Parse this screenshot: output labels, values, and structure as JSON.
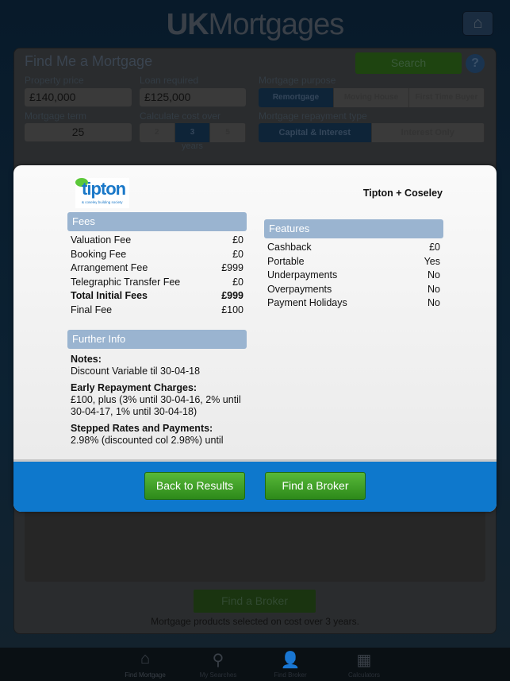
{
  "header": {
    "title_bold": "UK",
    "title_rest": "Mortgages",
    "home_icon": "home-icon"
  },
  "form": {
    "heading": "Find Me a Mortgage",
    "search_label": "Search",
    "help_label": "?",
    "property_price_label": "Property price",
    "property_price": "£140,000",
    "loan_label": "Loan required",
    "loan": "£125,000",
    "term_label": "Mortgage term",
    "term": "25",
    "cost_label": "Calculate cost over",
    "cost_options": [
      "2",
      "3",
      "5"
    ],
    "cost_selected": "3",
    "years_label": "years",
    "purpose_label": "Mortgage purpose",
    "purpose_options": [
      "Remortgage",
      "Moving House",
      "First Time Buyer"
    ],
    "purpose_selected": "Remortgage",
    "repayment_label": "Mortgage repayment type",
    "repayment_options": [
      "Capital & Interest",
      "Interest Only"
    ],
    "repayment_selected": "Capital & Interest"
  },
  "results": {
    "find_broker": "Find a Broker",
    "note": "Mortgage products selected on cost over 3 years."
  },
  "tabbar": [
    {
      "label": "Find Mortgage",
      "icon": "home-icon"
    },
    {
      "label": "My Searches",
      "icon": "search-icon"
    },
    {
      "label": "Find Broker",
      "icon": "person-icon"
    },
    {
      "label": "Calculators",
      "icon": "calculator-icon"
    }
  ],
  "modal": {
    "logo_text": "the tipton",
    "logo_sub": "& coseley building society",
    "lender": "Tipton + Coseley",
    "fees_title": "Fees",
    "fees": [
      {
        "label": "Valuation Fee",
        "value": "£0"
      },
      {
        "label": "Booking Fee",
        "value": "£0"
      },
      {
        "label": "Arrangement Fee",
        "value": "£999"
      },
      {
        "label": "Telegraphic Transfer Fee",
        "value": "£0"
      },
      {
        "label": "Total Initial Fees",
        "value": "£999"
      },
      {
        "label": "Final Fee",
        "value": "£100"
      }
    ],
    "features_title": "Features",
    "features": [
      {
        "label": "Cashback",
        "value": "£0"
      },
      {
        "label": "Portable",
        "value": "Yes"
      },
      {
        "label": "Underpayments",
        "value": "No"
      },
      {
        "label": "Overpayments",
        "value": "No"
      },
      {
        "label": "Payment Holidays",
        "value": "No"
      }
    ],
    "further_title": "Further Info",
    "notes_title": "Notes:",
    "notes": "Discount Variable til 30-04-18",
    "erc_title": "Early Repayment Charges:",
    "erc": "£100, plus (3% until 30-04-16, 2% until 30-04-17, 1% until 30-04-18)",
    "stepped_title": "Stepped Rates and Payments:",
    "stepped": "2.98% (discounted col 2.98%) until",
    "back_label": "Back to Results",
    "broker_label": "Find a Broker"
  }
}
